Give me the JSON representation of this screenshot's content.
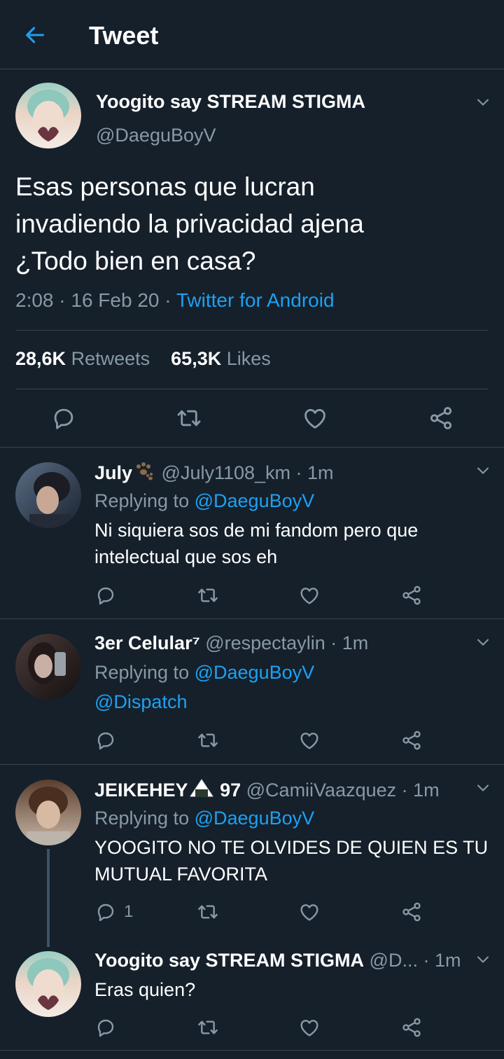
{
  "header": {
    "title": "Tweet"
  },
  "main_tweet": {
    "name": "Yoogito say STREAM STIGMA",
    "handle": "@DaeguBoyV",
    "lines": [
      "Esas personas que lucran",
      "invadiendo la privacidad ajena",
      "¿Todo bien en casa?"
    ],
    "time": "2:08 · 16 Feb 20 · ",
    "source": "Twitter for Android",
    "retweets_count": "28,6K",
    "retweets_label": "Retweets",
    "likes_count": "65,3K",
    "likes_label": "Likes"
  },
  "replies": [
    {
      "name": "July",
      "handle": "@July1108_km · 1m",
      "replying_label": "Replying to",
      "replying_to": "@DaeguBoyV",
      "lines": [
        "Ni siquiera sos de mi fandom pero que",
        "intelectual que sos eh"
      ]
    },
    {
      "name": "3er Celular⁷",
      "handle": "@respectaylin · 1m",
      "replying_label": "Replying to",
      "replying_to": "@DaeguBoyV",
      "lines": [
        "@Dispatch"
      ]
    },
    {
      "name": "JEIKEHEY",
      "name_suffix": "97",
      "handle": "@CamiiVaazquez · 1m",
      "replying_label": "Replying to",
      "replying_to": "@DaeguBoyV",
      "lines": [
        "YOOGITO NO TE OLVIDES DE QUIEN ES TU",
        "MUTUAL FAVORITA"
      ],
      "reply_count": "1"
    },
    {
      "name": "Yoogito say STREAM STIGMA",
      "handle": "@D...",
      "time": "· 1m",
      "lines": [
        "Eras quien?"
      ]
    }
  ],
  "icons": {
    "back": "arrow-left-icon",
    "reply": "speech-bubble-icon",
    "retweet": "retweet-icon",
    "like": "heart-icon",
    "share": "share-icon",
    "more": "chevron-down-icon"
  },
  "colors": {
    "background": "#15202b",
    "accent": "#1da1f2",
    "secondary_text": "#8899a6",
    "divider": "#38444d"
  }
}
